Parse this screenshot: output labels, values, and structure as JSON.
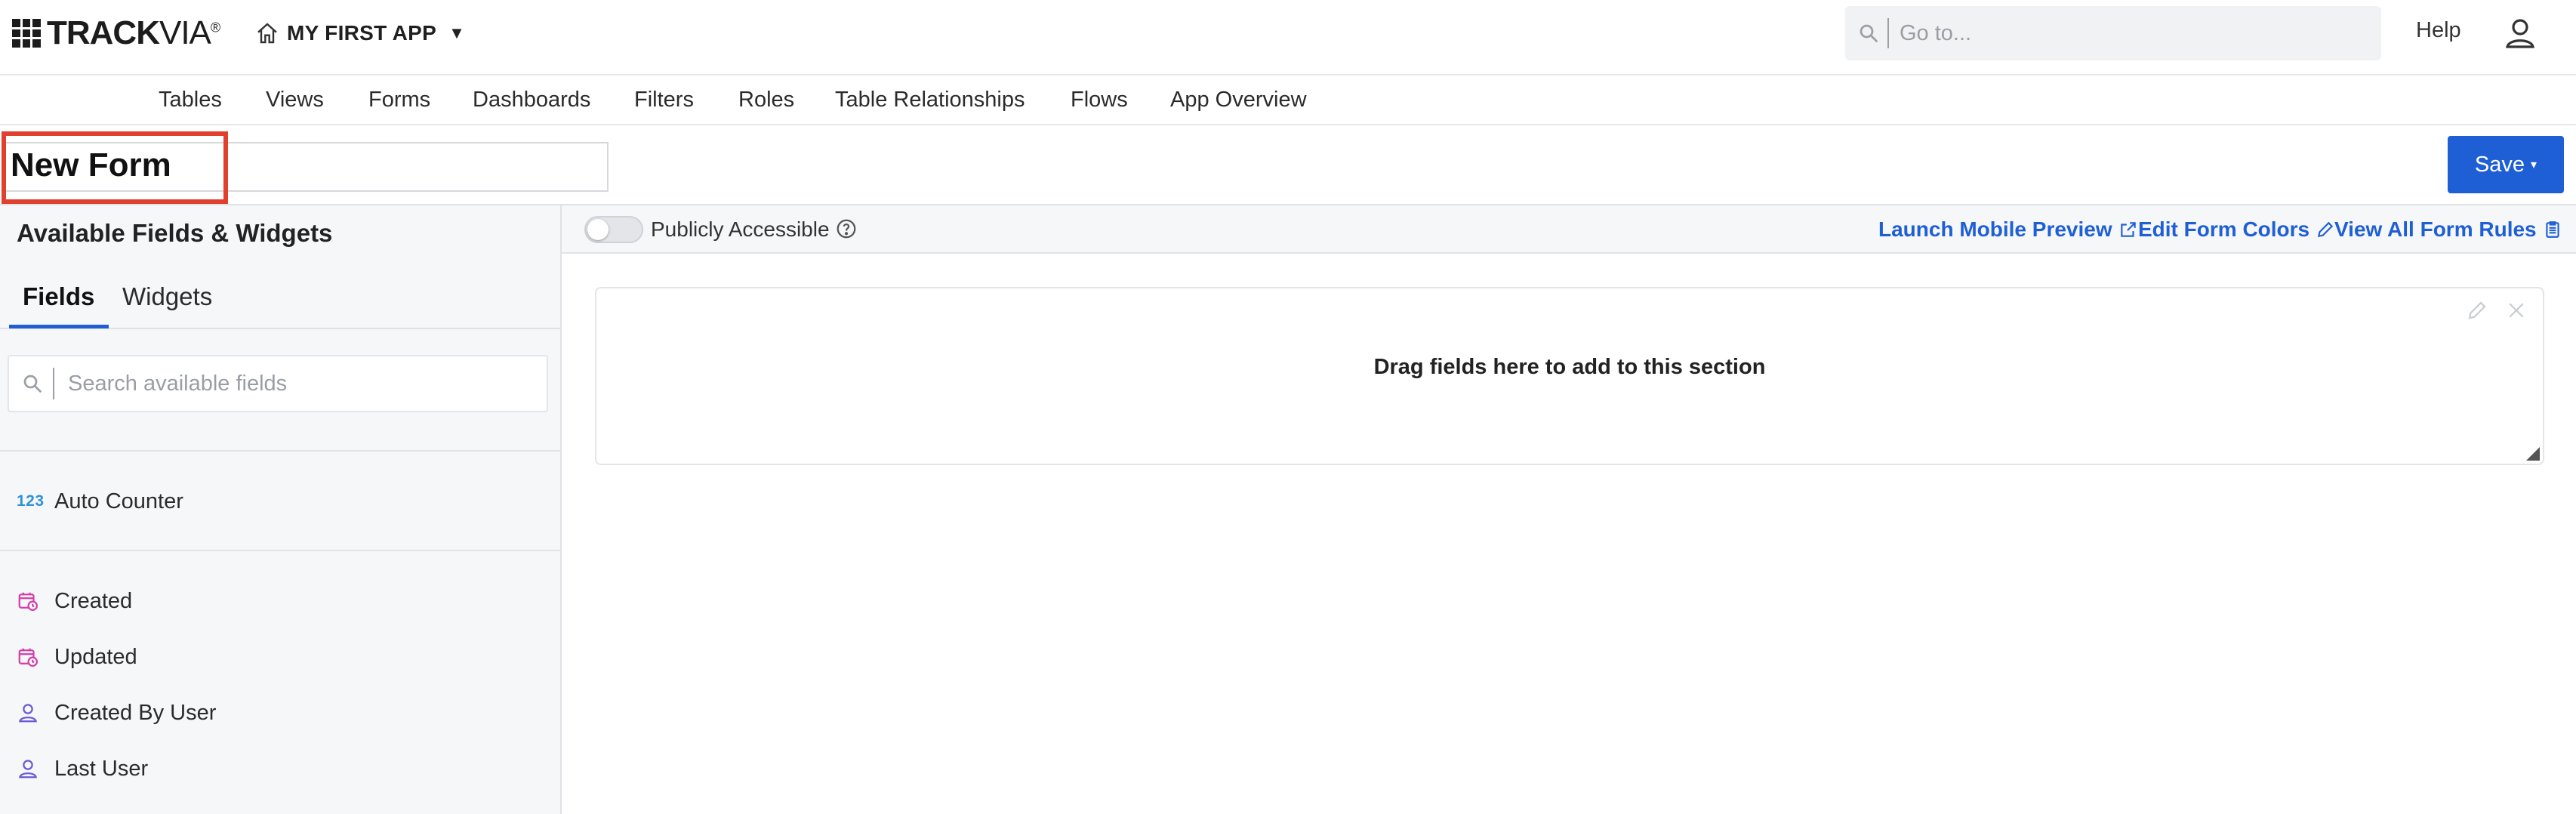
{
  "brand": {
    "logo_text_bold": "TRACK",
    "logo_text_light": "VIA",
    "logo_mark": "®"
  },
  "app": {
    "name": "MY FIRST APP",
    "caret": "▼",
    "icon": "home-icon"
  },
  "global_search": {
    "placeholder": "Go to...",
    "icon": "search-icon"
  },
  "header": {
    "help_label": "Help",
    "user_icon": "user-icon"
  },
  "nav": {
    "items": [
      "Tables",
      "Views",
      "Forms",
      "Dashboards",
      "Filters",
      "Roles",
      "Table Relationships",
      "Flows",
      "App Overview"
    ]
  },
  "form": {
    "title": "New Form",
    "save_label": "Save",
    "save_caret": "▾",
    "highlight_color": "#e0412f"
  },
  "left_panel": {
    "title": "Available Fields & Widgets",
    "tabs": [
      "Fields",
      "Widgets"
    ],
    "active_tab": "Fields",
    "search_placeholder": "Search available fields",
    "groups": [
      {
        "items": [
          {
            "label": "Auto Counter",
            "icon": "123"
          }
        ]
      },
      {
        "items": [
          {
            "label": "Created",
            "icon": "calendar-clock-icon"
          },
          {
            "label": "Updated",
            "icon": "calendar-clock-icon"
          },
          {
            "label": "Created By User",
            "icon": "user-icon"
          },
          {
            "label": "Last User",
            "icon": "user-icon"
          }
        ]
      }
    ]
  },
  "toolbar": {
    "toggle_label": "Publicly Accessible",
    "toggle_on": false,
    "help_icon": "question-circle-icon",
    "launch_preview": "Launch Mobile Preview",
    "edit_colors": "Edit Form Colors",
    "view_rules": "View All Form Rules"
  },
  "section": {
    "empty_message": "Drag fields here to add to this section"
  },
  "colors": {
    "accent": "#1f5fd6",
    "panel_bg": "#f6f7f9",
    "number_icon": "#2f93d6",
    "date_icon": "#d23fa8",
    "user_icon": "#6a5ad6"
  }
}
